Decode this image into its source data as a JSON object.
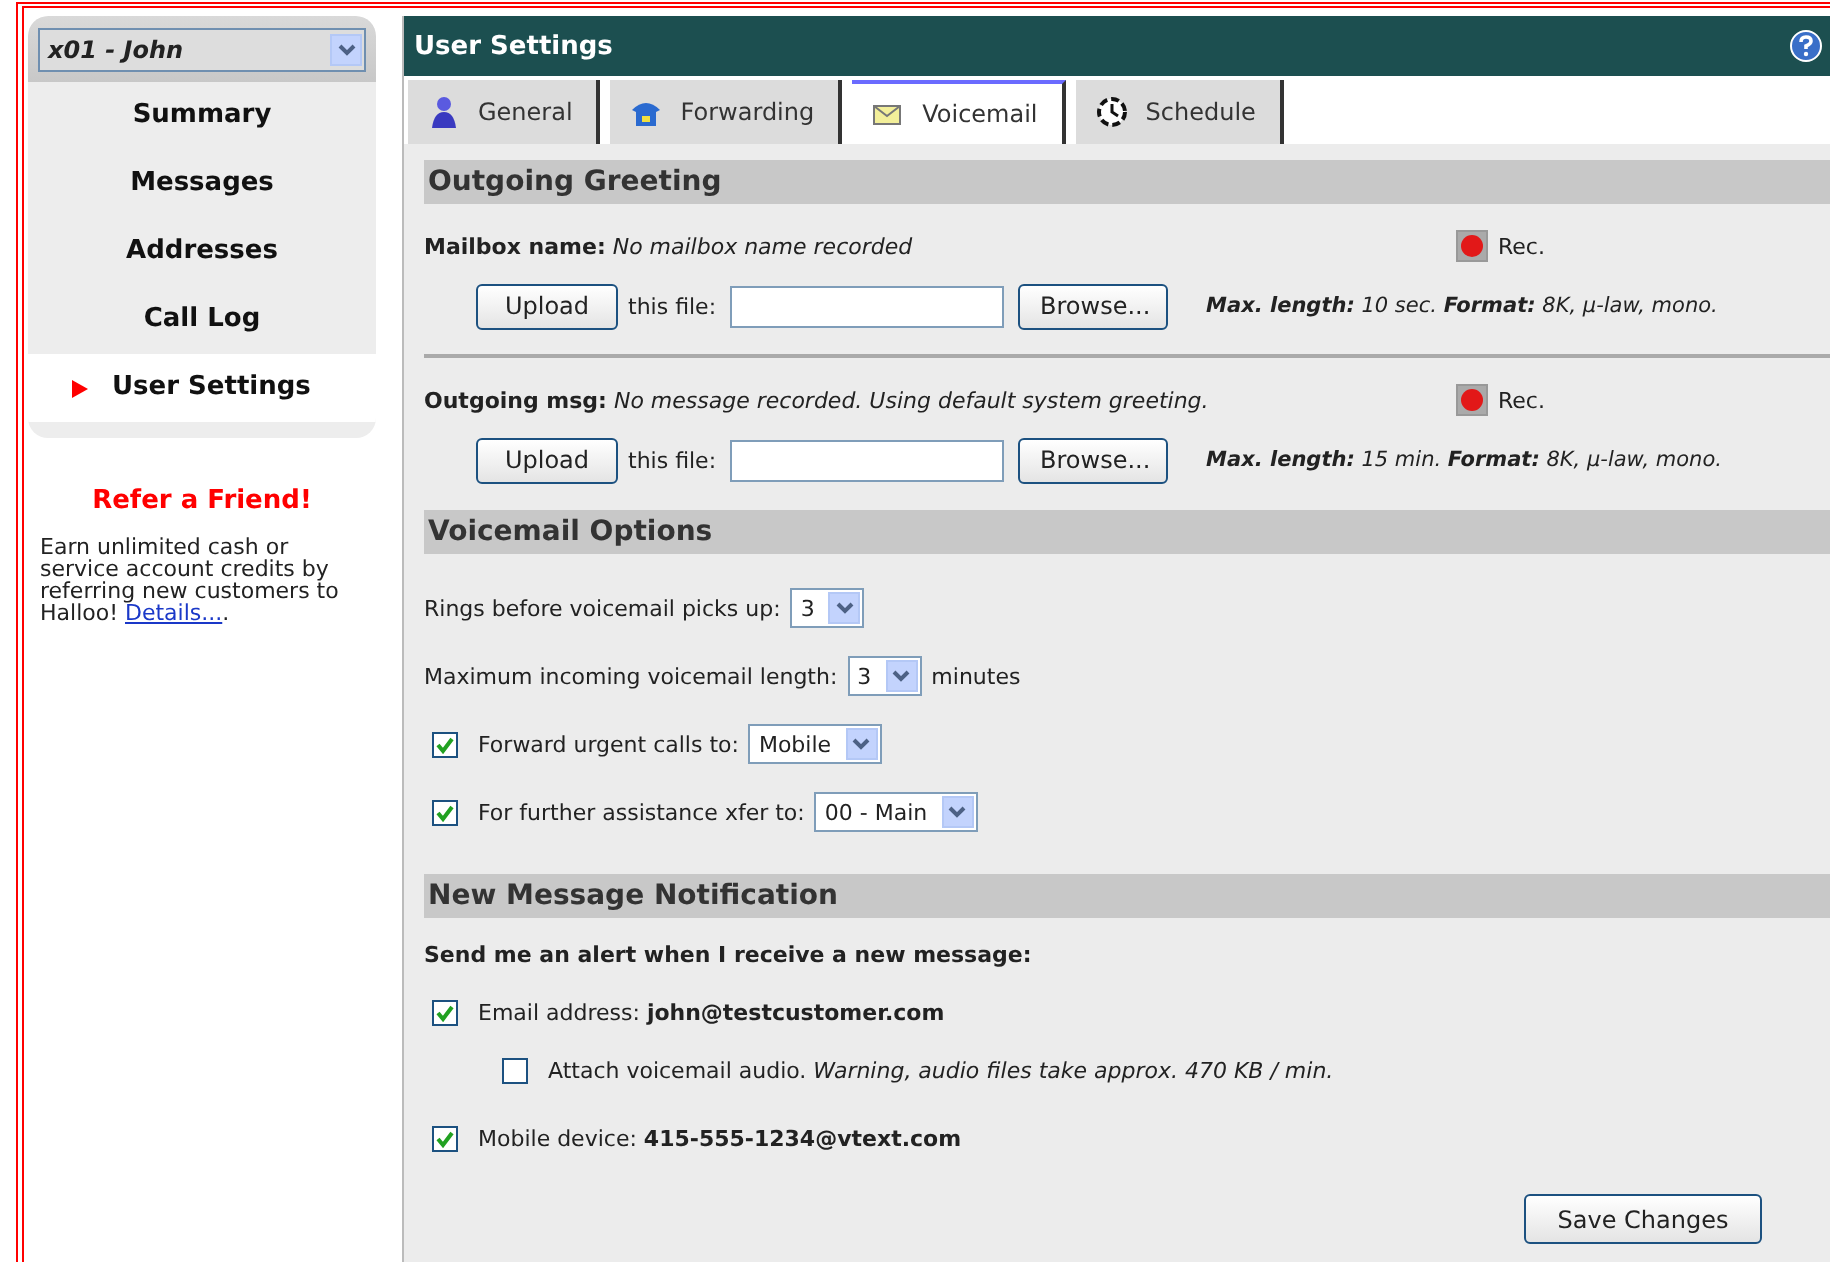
{
  "account_select": {
    "value": "x01 - John"
  },
  "nav": [
    {
      "label": "Summary",
      "selected": false
    },
    {
      "label": "Messages",
      "selected": false
    },
    {
      "label": "Addresses",
      "selected": false
    },
    {
      "label": "Call Log",
      "selected": false
    },
    {
      "label": "User Settings",
      "selected": true
    }
  ],
  "promo": {
    "title": "Refer a Friend!",
    "text": "Earn unlimited cash or service account credits by referring new customers to Halloo!",
    "link": "Details...",
    "after_link": "."
  },
  "panel": {
    "title": "User Settings"
  },
  "tabs": [
    {
      "label": "General",
      "selected": false
    },
    {
      "label": "Forwarding",
      "selected": false
    },
    {
      "label": "Voicemail",
      "selected": true
    },
    {
      "label": "Schedule",
      "selected": false
    }
  ],
  "greeting": {
    "title": "Outgoing Greeting",
    "items": [
      {
        "status": "**Mailbox name:** *No mailbox name recorded*",
        "rec_label": "Rec.",
        "upload_button": "Upload",
        "file_label": "this file:",
        "browse_button": "Browse...",
        "limits": "**Max. length:** 10 sec.  **Format:** 8K, µ-law, mono."
      },
      {
        "status": "**Outgoing msg:** *No message recorded. Using default system greeting.*",
        "rec_label": "Rec.",
        "upload_button": "Upload",
        "file_label": "this file:",
        "browse_button": "Browse...",
        "limits": "**Max. length:** 15 min.  **Format:** 8K, µ-law, mono."
      }
    ]
  },
  "options": {
    "title": "Voicemail Options",
    "rows": [
      {
        "kind": "select",
        "label": "Rings before voicemail picks up:",
        "value": "3"
      },
      {
        "kind": "select",
        "label": "Maximum incoming voicemail length:",
        "value": "3",
        "suffix": "minutes"
      },
      {
        "kind": "checkbox-select",
        "checked": true,
        "label": "Forward urgent calls to:",
        "value": "Mobile"
      },
      {
        "kind": "checkbox-select",
        "checked": true,
        "label": "For further assistance xfer to:",
        "value": "00 - Main"
      }
    ]
  },
  "notification": {
    "title": "New Message Notification",
    "intro": "Send me an alert when I receive a new message:",
    "items": [
      {
        "checked": true,
        "label": "Email address: **john@testcustomer.com**",
        "children": [
          {
            "checked": false,
            "label": "Attach voicemail audio. *Warning, audio files take approx. 470 KB / min.*"
          }
        ]
      },
      {
        "checked": true,
        "label": "Mobile device: **415-555-1234@vtext.com**"
      }
    ]
  },
  "save_button": "Save Changes"
}
